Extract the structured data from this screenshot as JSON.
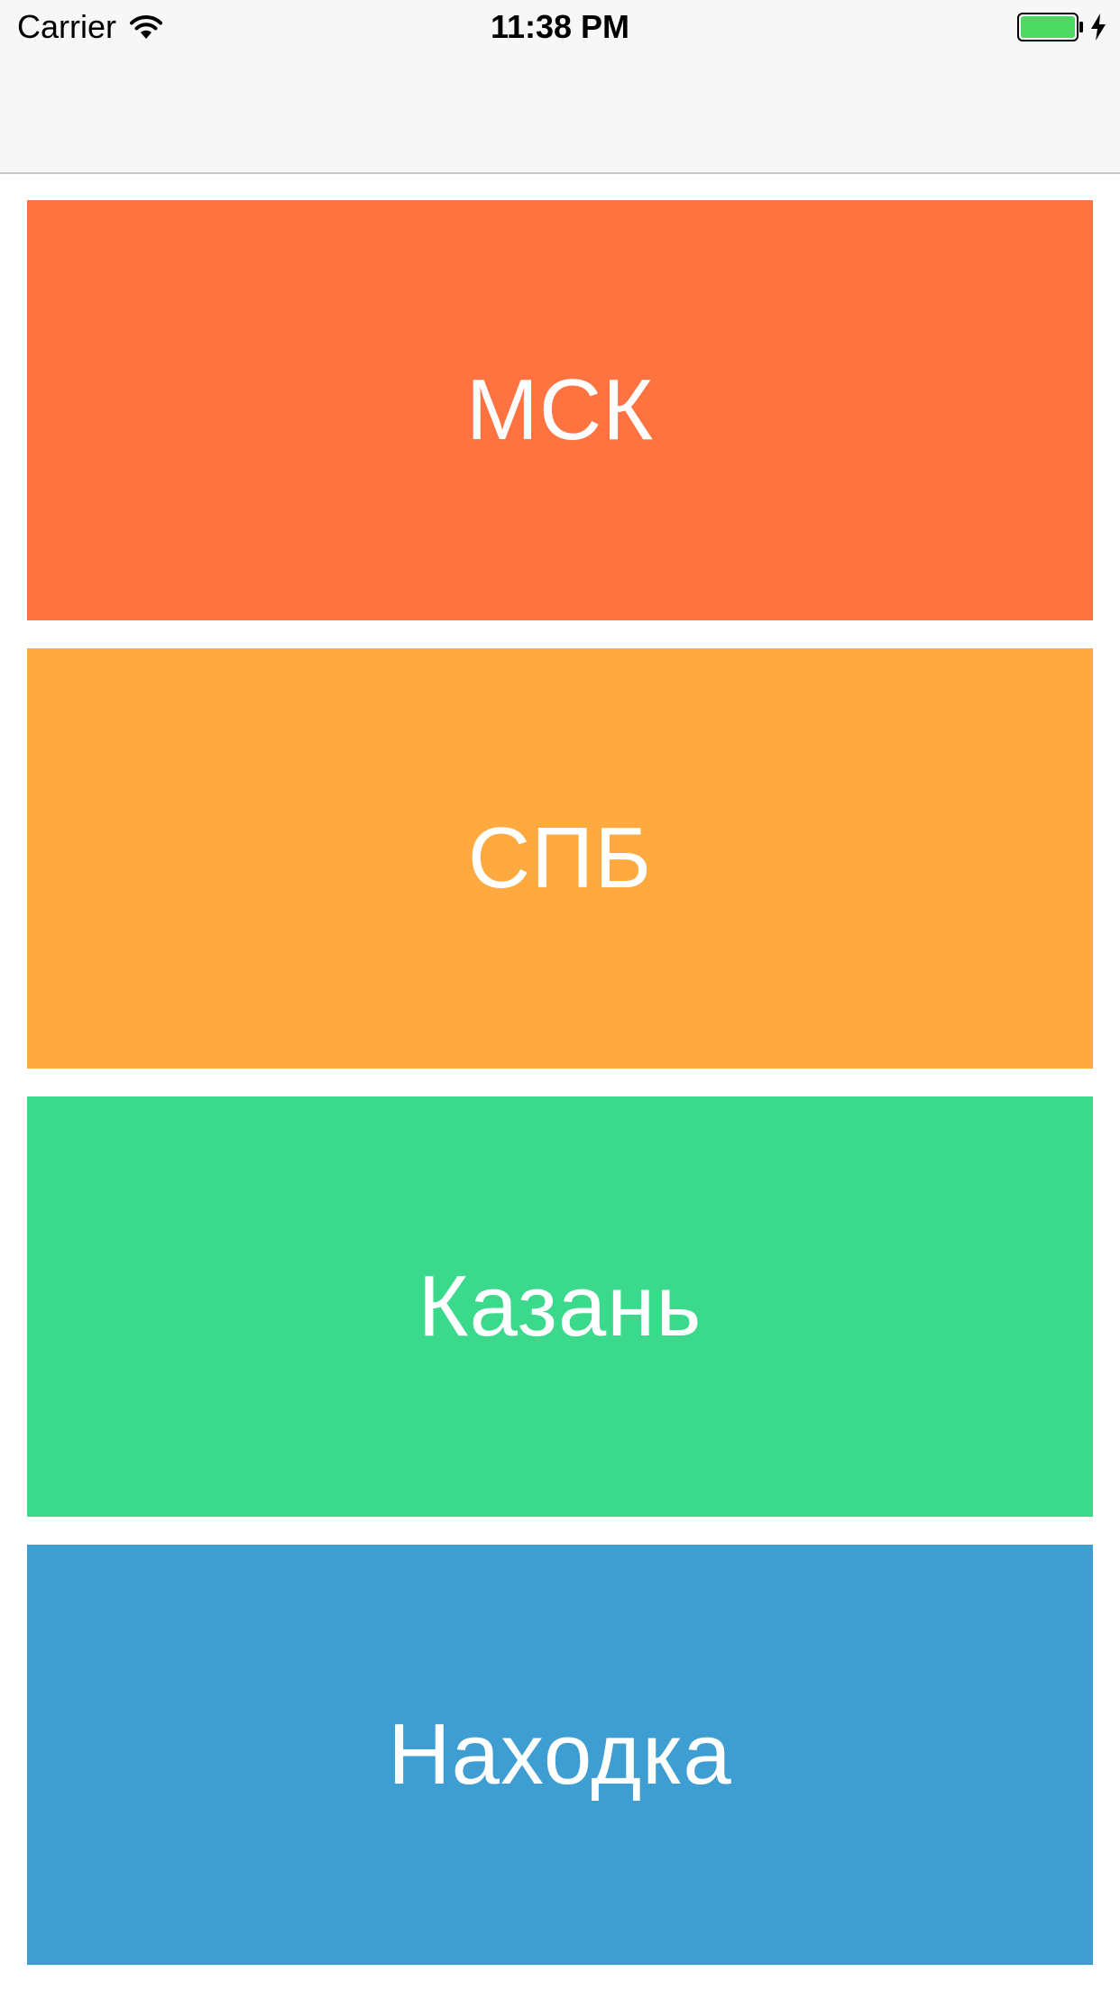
{
  "status_bar": {
    "carrier": "Carrier",
    "time": "11:38 PM",
    "wifi_icon": "wifi-icon",
    "battery_icon": "battery-icon",
    "charging_icon": "bolt-icon",
    "battery_color": "#4cd964"
  },
  "cities": [
    {
      "label": "МСК",
      "color": "#ff7341"
    },
    {
      "label": "СПБ",
      "color": "#ffa941"
    },
    {
      "label": "Казань",
      "color": "#3ad98b"
    },
    {
      "label": "Находка",
      "color": "#3e9ed1"
    }
  ]
}
